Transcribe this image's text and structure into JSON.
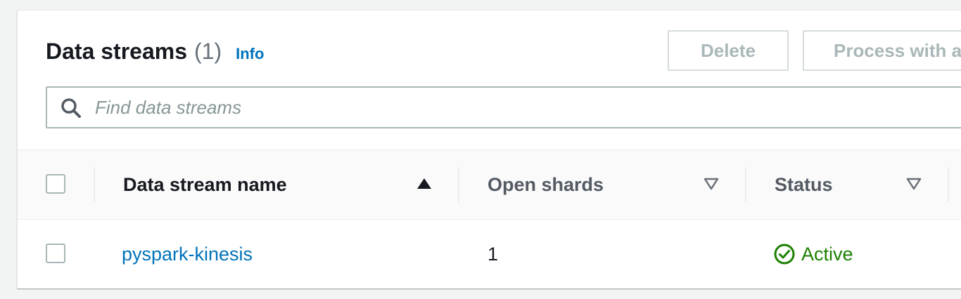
{
  "header": {
    "title": "Data streams",
    "count": "(1)",
    "info_link": "Info"
  },
  "actions": {
    "delete_label": "Delete",
    "process_label": "Process with a"
  },
  "search": {
    "placeholder": "Find data streams",
    "value": ""
  },
  "table": {
    "columns": [
      {
        "label": "Data stream name",
        "sort": "ascending"
      },
      {
        "label": "Open shards",
        "sort": "none"
      },
      {
        "label": "Status",
        "sort": "none"
      }
    ],
    "rows": [
      {
        "name": "pyspark-kinesis",
        "open_shards": "1",
        "status": "Active"
      }
    ]
  },
  "colors": {
    "link": "#0073bb",
    "status_active": "#1d8102",
    "disabled_text": "#aab7b8"
  },
  "icons": [
    "search-icon",
    "sort-ascending-icon",
    "sort-descending-icon",
    "status-check-icon"
  ]
}
